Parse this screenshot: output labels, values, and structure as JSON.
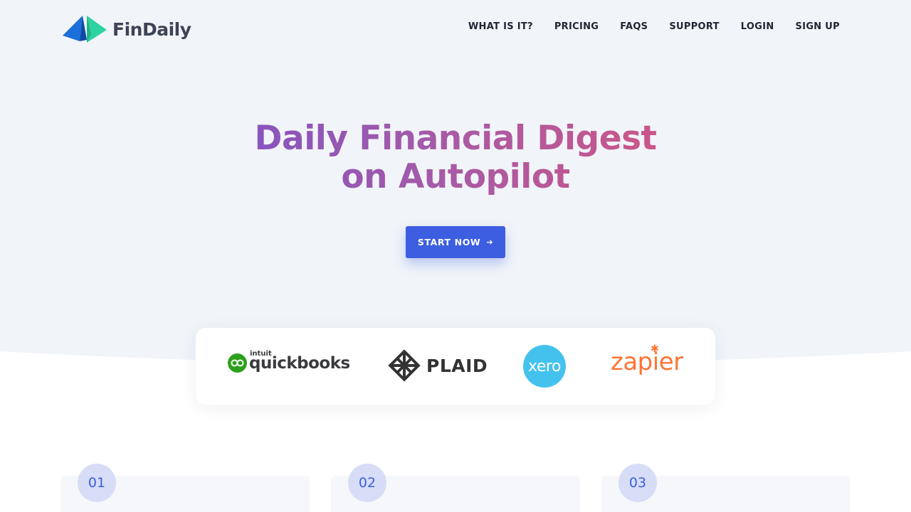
{
  "header": {
    "logo_text": "FinDaily",
    "nav": [
      "WHAT IS IT?",
      "PRICING",
      "FAQS",
      "SUPPORT",
      "LOGIN",
      "SIGN UP"
    ]
  },
  "hero": {
    "headline_line1": "Daily Financial Digest",
    "headline_line2": "on Autopilot",
    "cta_label": "START NOW",
    "cta_icon": "arrow-right-icon"
  },
  "partners": {
    "quickbooks_small": "intuit",
    "quickbooks_word": "quickbooks",
    "plaid": "PLAID",
    "xero": "xero",
    "zapier": "zapier"
  },
  "steps": [
    "01",
    "02",
    "03"
  ],
  "colors": {
    "accent": "#3d5ee0",
    "hero_bg": "#f1f4f9",
    "headline_gradient_start": "#7b52c7",
    "headline_gradient_end": "#d9557e"
  }
}
